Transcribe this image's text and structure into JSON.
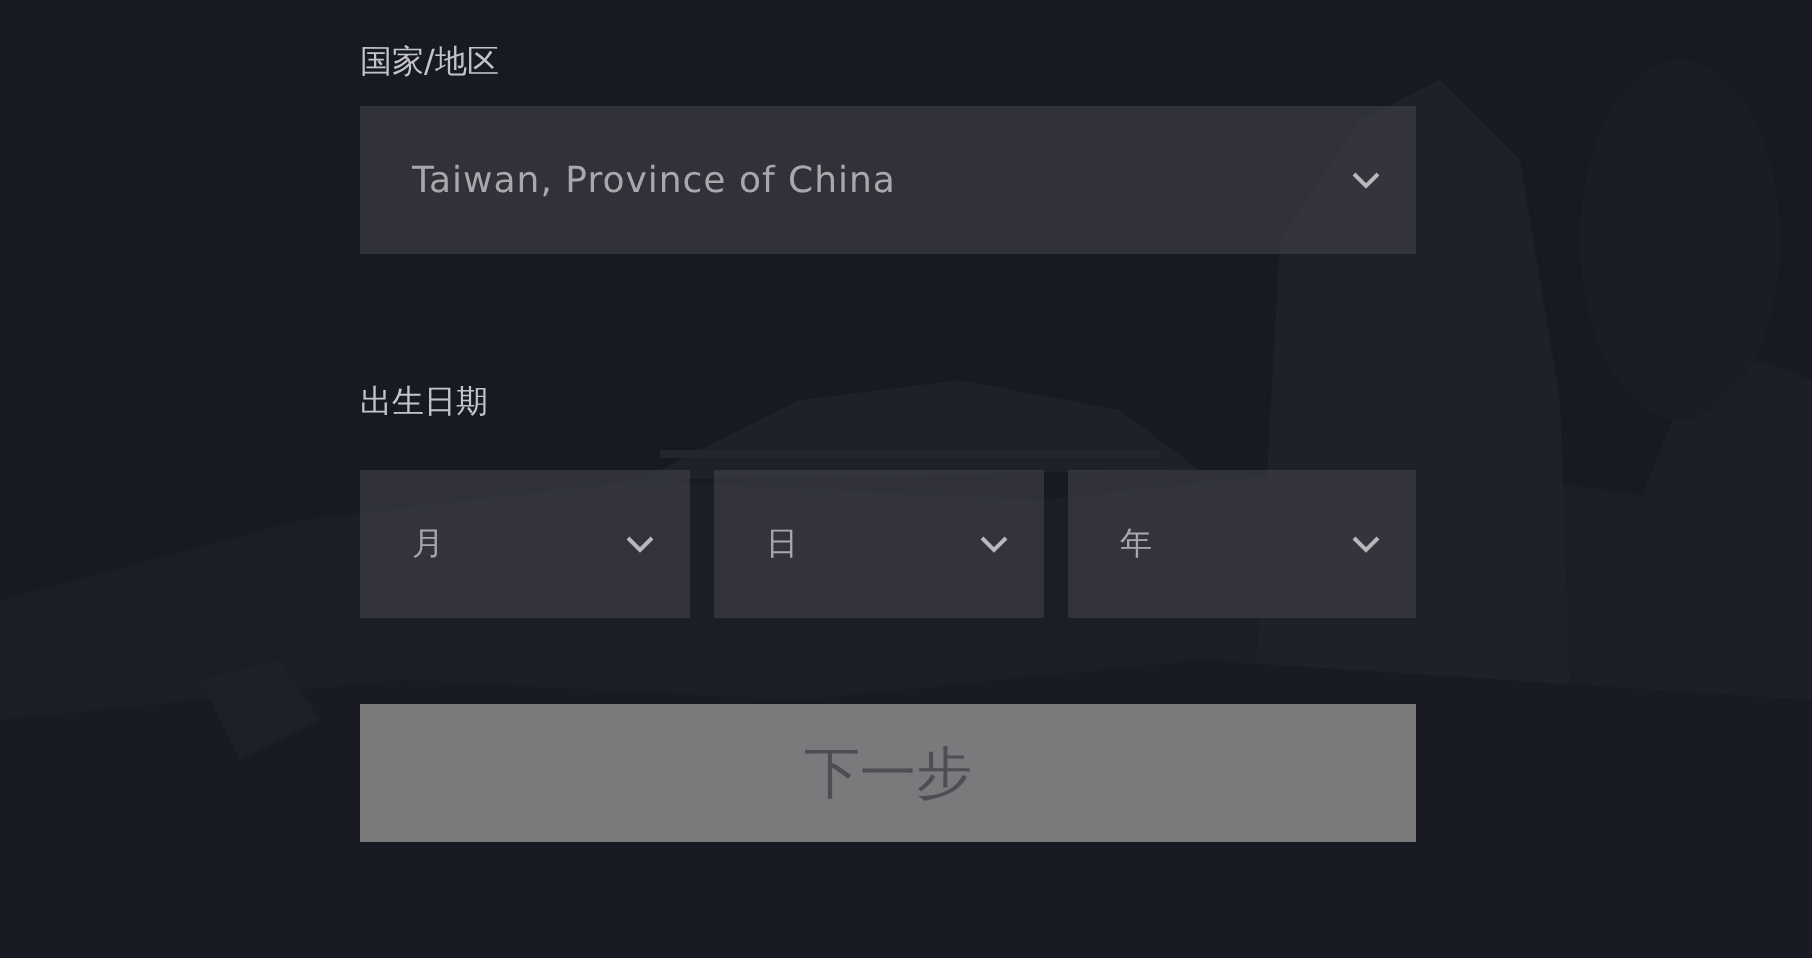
{
  "country": {
    "label": "国家/地区",
    "value": "Taiwan, Province of China"
  },
  "birth_date": {
    "label": "出生日期",
    "fields": [
      {
        "placeholder": "月"
      },
      {
        "placeholder": "日"
      },
      {
        "placeholder": "年"
      }
    ]
  },
  "next_button": {
    "label": "下一步",
    "disabled": true
  }
}
